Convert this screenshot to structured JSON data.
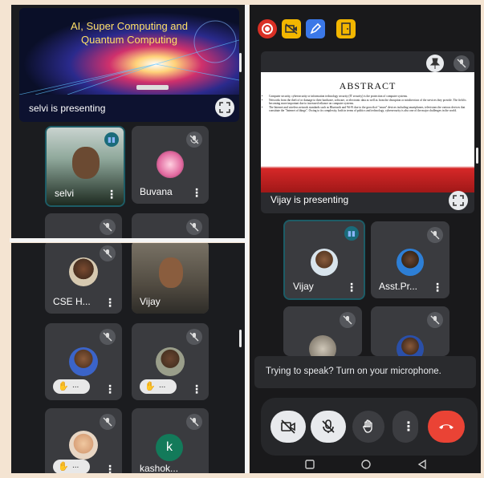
{
  "left_top": {
    "presentation": {
      "slide_title_line1": "AI, Super Computing and",
      "slide_title_line2": "Quantum Computing",
      "label": "selvi is presenting"
    },
    "tiles": [
      {
        "name": "selvi"
      },
      {
        "name": "Buvana"
      }
    ]
  },
  "left_bottom": {
    "tiles": [
      {
        "name": "CSE H..."
      },
      {
        "name": "Vijay"
      },
      {
        "pill": "..."
      },
      {
        "pill": "..."
      },
      {
        "pill": "..."
      },
      {
        "name": "kashok...",
        "avatar_letter": "k"
      }
    ]
  },
  "right": {
    "presentation": {
      "slide_heading": "ABSTRACT",
      "bullets": [
        "Computer security, cybersecurity or information technology security (IT security) is the protection of computer systems.",
        "Networks from the theft of or damage to their hardware, software, or electronic data as well as from the disruption or misdirection of the services they provide. The field is becoming more important due to increased reliance on computer systems.",
        "The Internet and wireless network standards such as Bluetooth and Wi-Fi due to the growth of \"smart\" devices including smartphones, televisions the various devices that constitute the \"Internet of things\". Owing to its complexity, both in terms of politics and technology, cybersecurity is also one of the major challenges in the world.",
        "Today many nations and governments are imposing strict laws on cyber securities in order to prevent the loss of some important information.",
        "Every individual must also be trained on this cyber security and save themselves from these increasing cyber crimes."
      ],
      "label": "Vijay is presenting"
    },
    "tiles": [
      {
        "name": "Vijay"
      },
      {
        "name": "Asst.Pr..."
      }
    ],
    "toast": "Trying to speak? Turn on your microphone."
  },
  "colors": {
    "leave_button": "#ea4335",
    "speaking_indicator": "#8ab4f8",
    "panel_bg": "#1b1c1f",
    "tile_bg": "#3a3b3f"
  },
  "icons": [
    "record-icon",
    "no-camera-icon",
    "edit-icon",
    "exit-icon",
    "pin-icon",
    "mic-off-icon",
    "more-vert-icon",
    "raise-hand-icon",
    "end-call-icon",
    "fullscreen-icon"
  ]
}
